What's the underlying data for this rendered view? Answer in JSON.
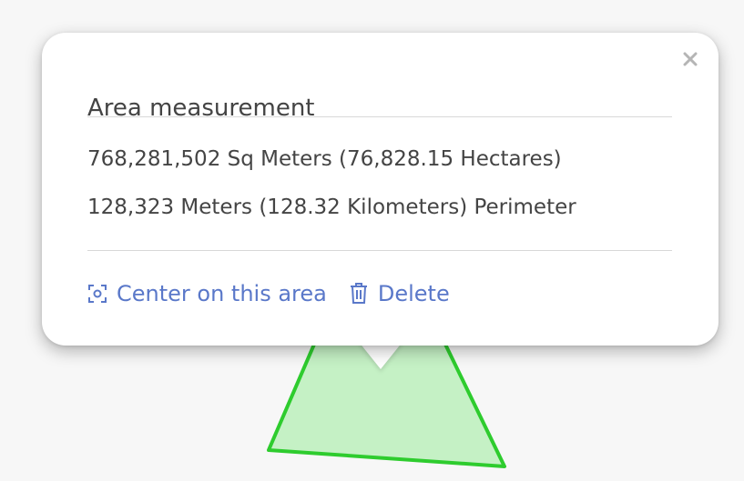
{
  "popup": {
    "title": "Area measurement",
    "area_text": "768,281,502 Sq Meters (76,828.15 Hectares)",
    "perimeter_text": "128,323 Meters (128.32 Kilometers) Perimeter",
    "close_icon": "close-icon",
    "actions": [
      {
        "label": "Center on this area",
        "icon": "center-focus-icon"
      },
      {
        "label": "Delete",
        "icon": "trash-icon"
      }
    ]
  },
  "colors": {
    "link": "#5a78c9",
    "text": "#444444",
    "polygon_fill": "#bff0bf",
    "polygon_stroke": "#2ecc2e"
  }
}
